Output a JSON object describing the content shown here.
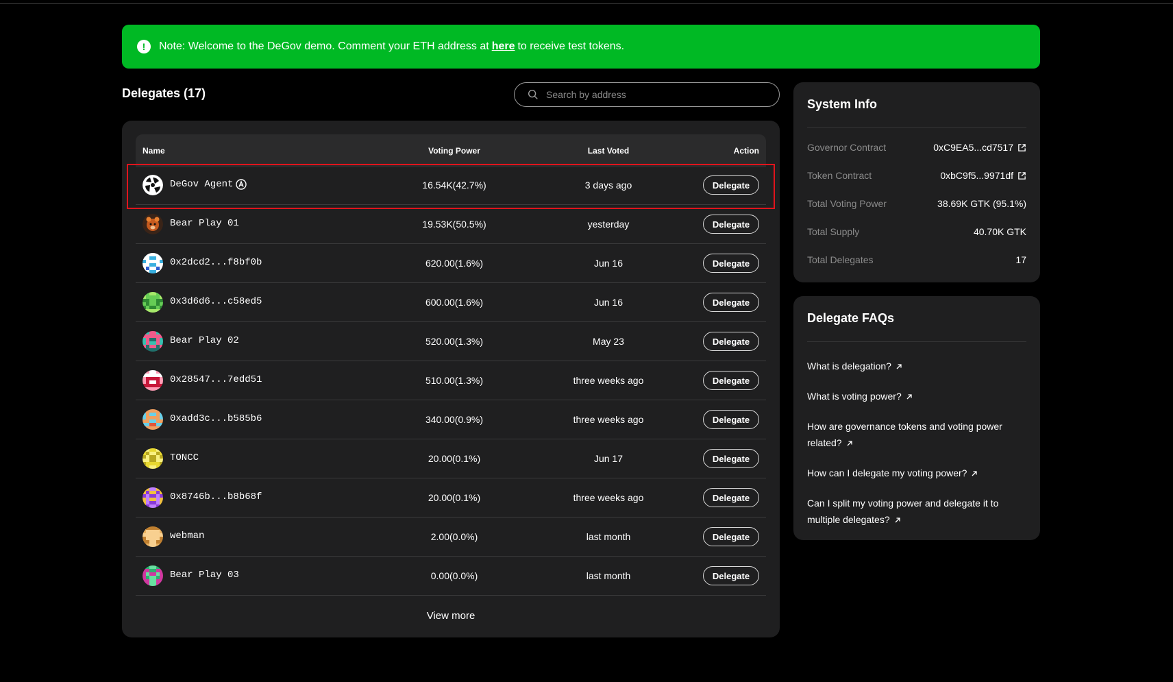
{
  "banner": {
    "text_before": "Note: Welcome to the DeGov demo. Comment your ETH address at",
    "link_text": "here",
    "text_after": "to receive test tokens."
  },
  "delegates": {
    "title": "Delegates (17)",
    "search_placeholder": "Search by address",
    "columns": {
      "name": "Name",
      "voting_power": "Voting Power",
      "last_voted": "Last Voted",
      "action": "Action"
    },
    "rows": [
      {
        "name": "DeGov Agent",
        "power": "16.54K(42.7%)",
        "voted": "3 days ago",
        "action": "Delegate",
        "ai": true,
        "avatar": "degov"
      },
      {
        "name": "Bear Play 01",
        "power": "19.53K(50.5%)",
        "voted": "yesterday",
        "action": "Delegate",
        "avatar": "bear"
      },
      {
        "name": "0x2dcd2...f8bf0b",
        "power": "620.00(1.6%)",
        "voted": "Jun 16",
        "action": "Delegate",
        "avatar": "p1"
      },
      {
        "name": "0x3d6d6...c58ed5",
        "power": "600.00(1.6%)",
        "voted": "Jun 16",
        "action": "Delegate",
        "avatar": "p2"
      },
      {
        "name": "Bear Play 02",
        "power": "520.00(1.3%)",
        "voted": "May 23",
        "action": "Delegate",
        "avatar": "p3"
      },
      {
        "name": "0x28547...7edd51",
        "power": "510.00(1.3%)",
        "voted": "three weeks ago",
        "action": "Delegate",
        "avatar": "p4"
      },
      {
        "name": "0xadd3c...b585b6",
        "power": "340.00(0.9%)",
        "voted": "three weeks ago",
        "action": "Delegate",
        "avatar": "p5"
      },
      {
        "name": "TONCC",
        "power": "20.00(0.1%)",
        "voted": "Jun 17",
        "action": "Delegate",
        "avatar": "p6"
      },
      {
        "name": "0x8746b...b8b68f",
        "power": "20.00(0.1%)",
        "voted": "three weeks ago",
        "action": "Delegate",
        "avatar": "p7"
      },
      {
        "name": "webman",
        "power": "2.00(0.0%)",
        "voted": "last month",
        "action": "Delegate",
        "avatar": "p8"
      },
      {
        "name": "Bear Play 03",
        "power": "0.00(0.0%)",
        "voted": "last month",
        "action": "Delegate",
        "avatar": "p9"
      }
    ],
    "view_more": "View more"
  },
  "system_info": {
    "title": "System Info",
    "items": [
      {
        "label": "Governor Contract",
        "value": "0xC9EA5...cd7517",
        "external": true
      },
      {
        "label": "Token Contract",
        "value": "0xbC9f5...9971df",
        "external": true
      },
      {
        "label": "Total Voting Power",
        "value": "38.69K GTK (95.1%)"
      },
      {
        "label": "Total Supply",
        "value": "40.70K GTK"
      },
      {
        "label": "Total Delegates",
        "value": "17"
      }
    ]
  },
  "faqs": {
    "title": "Delegate FAQs",
    "items": [
      "What is delegation?",
      "What is voting power?",
      "How are governance tokens and voting power related?",
      "How can I delegate my voting power?",
      "Can I split my voting power and delegate it to multiple delegates?"
    ]
  },
  "colors": {
    "banner": "#00b924",
    "card": "#1f1f20",
    "highlight": "#e0141c"
  }
}
